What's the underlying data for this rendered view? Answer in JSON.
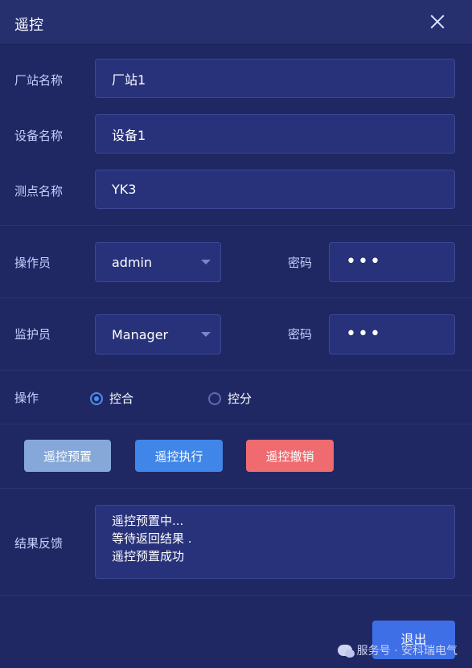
{
  "dialog": {
    "title": "遥控",
    "close_icon": "close-icon"
  },
  "station": {
    "label": "厂站名称",
    "value": "厂站1"
  },
  "device": {
    "label": "设备名称",
    "value": "设备1"
  },
  "point": {
    "label": "测点名称",
    "value": "YK3"
  },
  "operator": {
    "label": "操作员",
    "selected": "admin",
    "password_label": "密码",
    "password_mask": "•••"
  },
  "supervisor": {
    "label": "监护员",
    "selected": "Manager",
    "password_label": "密码",
    "password_mask": "•••"
  },
  "operation": {
    "label": "操作",
    "options": [
      {
        "label": "控合",
        "checked": true
      },
      {
        "label": "控分",
        "checked": false
      }
    ]
  },
  "actions": {
    "preset": {
      "label": "遥控预置",
      "color": "#86a8d8"
    },
    "execute": {
      "label": "遥控执行",
      "color": "#3f86e8"
    },
    "cancel": {
      "label": "遥控撤销",
      "color": "#ef6b6f"
    }
  },
  "feedback": {
    "label": "结果反馈",
    "lines": [
      "遥控预置中...",
      "等待返回结果 .",
      "遥控预置成功"
    ]
  },
  "exit": {
    "label": "退出"
  },
  "watermark": {
    "text": "服务号 · 安科瑞电气"
  }
}
